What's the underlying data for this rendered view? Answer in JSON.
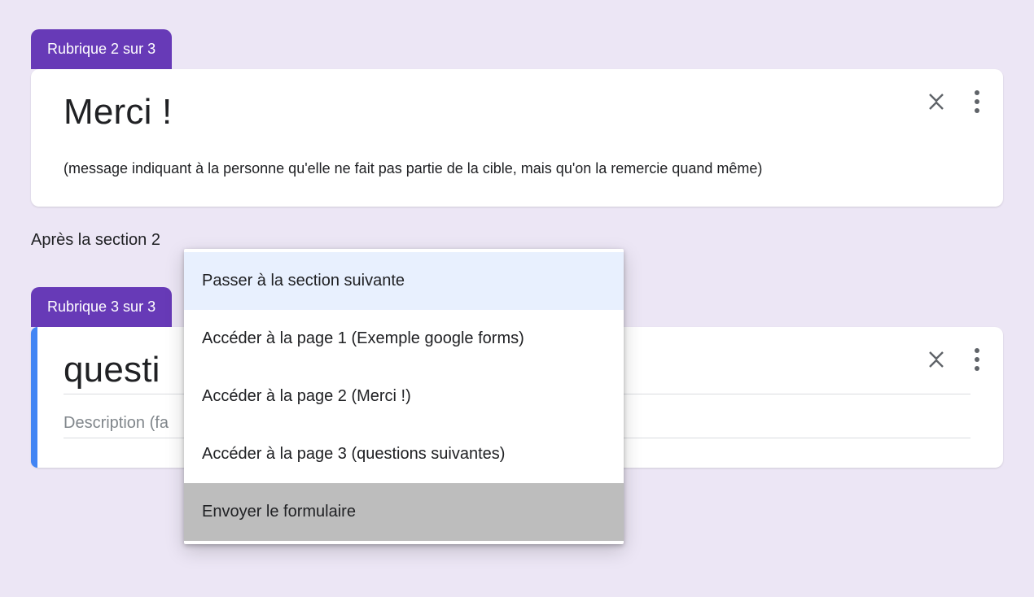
{
  "section2": {
    "tab": "Rubrique 2 sur 3",
    "title": "Merci !",
    "description": "(message indiquant à la personne qu'elle ne fait pas partie de la cible, mais qu'on la remercie quand même)"
  },
  "after_label_prefix": "Après la section 2",
  "section3": {
    "tab": "Rubrique 3 sur 3",
    "title": "questi",
    "description_placeholder": "Description (fa"
  },
  "menu": {
    "items": [
      "Passer à la section suivante",
      "Accéder à la page 1 (Exemple google forms)",
      "Accéder à la page 2 (Merci !)",
      "Accéder à la page 3 (questions suivantes)",
      "Envoyer le formulaire"
    ],
    "hovered_index": 0,
    "selected_index": 4
  }
}
